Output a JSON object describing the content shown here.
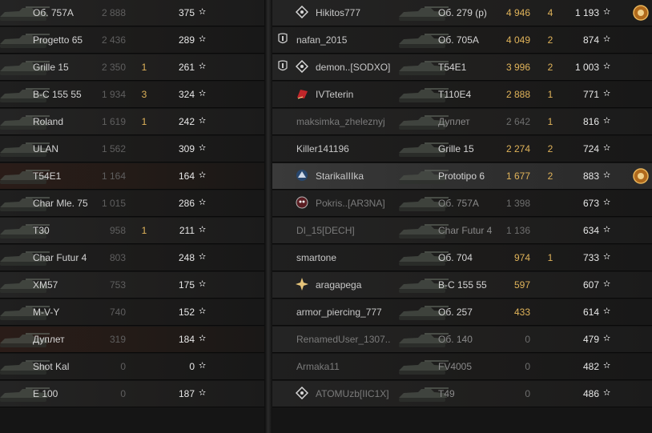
{
  "left_team": [
    {
      "vehicle": "Об. 757А",
      "damage": "2 888",
      "kills": "",
      "xp": "375",
      "bg": "alt-a"
    },
    {
      "vehicle": "Progetto 65",
      "damage": "2 436",
      "kills": "",
      "xp": "289",
      "bg": "alt-b"
    },
    {
      "vehicle": "Grille 15",
      "damage": "2 350",
      "kills": "1",
      "xp": "261",
      "bg": "alt-a"
    },
    {
      "vehicle": "B-C 155 55",
      "damage": "1 934",
      "kills": "3",
      "xp": "324",
      "bg": "alt-b"
    },
    {
      "vehicle": "Roland",
      "damage": "1 619",
      "kills": "1",
      "xp": "242",
      "bg": "alt-a"
    },
    {
      "vehicle": "ULAN",
      "damage": "1 562",
      "kills": "",
      "xp": "309",
      "bg": "alt-b"
    },
    {
      "vehicle": "T54E1",
      "damage": "1 164",
      "kills": "",
      "xp": "164",
      "bg": "dim-red"
    },
    {
      "vehicle": "Char Mle. 75",
      "damage": "1 015",
      "kills": "",
      "xp": "286",
      "bg": "alt-b"
    },
    {
      "vehicle": "T30",
      "damage": "958",
      "kills": "1",
      "xp": "211",
      "bg": "alt-a"
    },
    {
      "vehicle": "Char Futur 4",
      "damage": "803",
      "kills": "",
      "xp": "248",
      "bg": "alt-b"
    },
    {
      "vehicle": "XM57",
      "damage": "753",
      "kills": "",
      "xp": "175",
      "bg": "alt-a"
    },
    {
      "vehicle": "M-V-Y",
      "damage": "740",
      "kills": "",
      "xp": "152",
      "bg": "alt-b"
    },
    {
      "vehicle": "Дуплет",
      "damage": "319",
      "kills": "",
      "xp": "184",
      "bg": "dim-red"
    },
    {
      "vehicle": "Shot Kal",
      "damage": "0",
      "kills": "",
      "xp": "0",
      "bg": "alt-b"
    },
    {
      "vehicle": "E 100",
      "damage": "0",
      "kills": "",
      "xp": "187",
      "bg": "alt-a"
    }
  ],
  "right_team": [
    {
      "player": "Hikitos777",
      "vehicle": "Об. 279 (р)",
      "damage": "4 946",
      "kills": "4",
      "xp": "1 193",
      "icon": "diamond-clan-icon",
      "platoon": false,
      "medal": true,
      "dead": false
    },
    {
      "player": "nafan_2015",
      "vehicle": "Об. 705А",
      "damage": "4 049",
      "kills": "2",
      "xp": "874",
      "icon": "",
      "platoon": true,
      "medal": false,
      "dead": false
    },
    {
      "player": "demon..[SODXO]",
      "vehicle": "T54E1",
      "damage": "3 996",
      "kills": "2",
      "xp": "1 003",
      "icon": "diamond-clan-icon",
      "platoon": true,
      "medal": false,
      "dead": false
    },
    {
      "player": "IVTeterin",
      "vehicle": "T110E4",
      "damage": "2 888",
      "kills": "1",
      "xp": "771",
      "icon": "red-flag-icon",
      "platoon": false,
      "medal": false,
      "dead": false
    },
    {
      "player": "maksimka_zheleznyj",
      "vehicle": "Дуплет",
      "damage": "2 642",
      "kills": "1",
      "xp": "816",
      "icon": "",
      "platoon": false,
      "medal": false,
      "dead": true
    },
    {
      "player": "Killer141196",
      "vehicle": "Grille 15",
      "damage": "2 274",
      "kills": "2",
      "xp": "724",
      "icon": "",
      "platoon": false,
      "medal": false,
      "dead": false
    },
    {
      "player": "StarikaIIIka",
      "vehicle": "Prototipo 6",
      "damage": "1 677",
      "kills": "2",
      "xp": "883",
      "icon": "wolf-clan-icon",
      "platoon": false,
      "medal": true,
      "dead": false,
      "highlight": true
    },
    {
      "player": "Pokris..[AR3NA]",
      "vehicle": "Об. 757А",
      "damage": "1 398",
      "kills": "",
      "xp": "673",
      "icon": "skull-clan-icon",
      "platoon": false,
      "medal": false,
      "dead": true
    },
    {
      "player": "DI_15[DECH]",
      "vehicle": "Char Futur 4",
      "damage": "1 136",
      "kills": "",
      "xp": "634",
      "icon": "",
      "platoon": false,
      "medal": false,
      "dead": true
    },
    {
      "player": "smartone",
      "vehicle": "Об. 704",
      "damage": "974",
      "kills": "1",
      "xp": "733",
      "icon": "",
      "platoon": false,
      "medal": false,
      "dead": false
    },
    {
      "player": "aragapega",
      "vehicle": "B-C 155 55",
      "damage": "597",
      "kills": "",
      "xp": "607",
      "icon": "gold-star-clan-icon",
      "platoon": false,
      "medal": false,
      "dead": false
    },
    {
      "player": "armor_piercing_777",
      "vehicle": "Об. 257",
      "damage": "433",
      "kills": "",
      "xp": "614",
      "icon": "",
      "platoon": false,
      "medal": false,
      "dead": false
    },
    {
      "player": "RenamedUser_1307..",
      "vehicle": "Об. 140",
      "damage": "0",
      "kills": "",
      "xp": "479",
      "icon": "",
      "platoon": false,
      "medal": false,
      "dead": true
    },
    {
      "player": "Armaka11",
      "vehicle": "FV4005",
      "damage": "0",
      "kills": "",
      "xp": "482",
      "icon": "",
      "platoon": false,
      "medal": false,
      "dead": true
    },
    {
      "player": "ATOMUzb[IIC1X]",
      "vehicle": "T49",
      "damage": "0",
      "kills": "",
      "xp": "486",
      "icon": "diamond-clan-icon",
      "platoon": false,
      "medal": false,
      "dead": true
    }
  ],
  "star_glyph": "✫",
  "colors": {
    "damage": "#e0b35a",
    "dead_text": "#7b7b7b",
    "alive_text": "#c8c8c8"
  }
}
